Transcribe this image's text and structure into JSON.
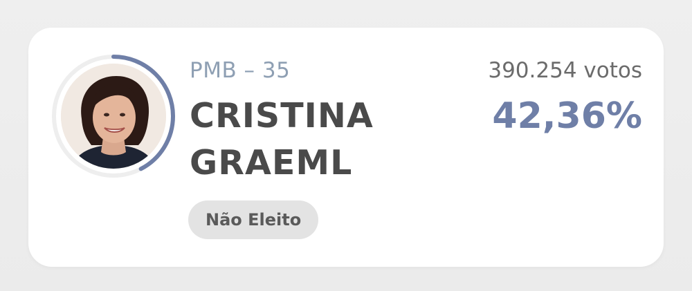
{
  "candidate": {
    "party_number": "PMB – 35",
    "name_line1": "CRISTINA",
    "name_line2": "GRAEML",
    "status": "Não Eleito",
    "votes": "390.254 votos",
    "percent": "42,36%",
    "vote_share_fraction": 0.4236
  },
  "colors": {
    "accent": "#6f7fa7",
    "ring_track": "#eeeeee",
    "party_text": "#8e9fb3",
    "name_text": "#4a4a4a",
    "status_bg": "#e3e3e3"
  },
  "icons": {
    "avatar": "candidate-photo"
  }
}
